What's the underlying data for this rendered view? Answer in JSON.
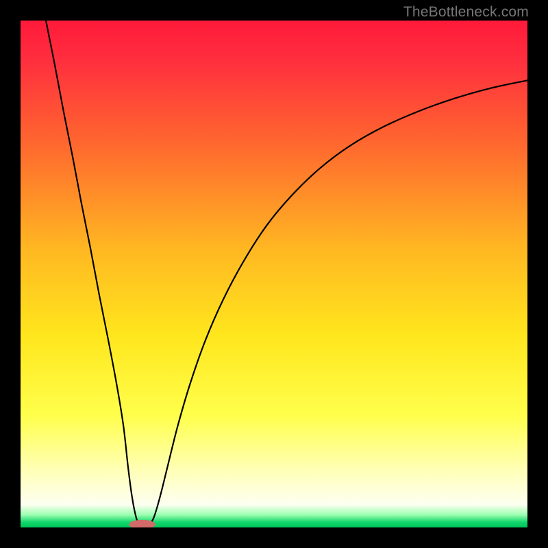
{
  "watermark": "TheBottleneck.com",
  "chart_data": {
    "type": "line",
    "title": "",
    "xlabel": "",
    "ylabel": "",
    "xlim": [
      0,
      100
    ],
    "ylim": [
      0,
      100
    ],
    "gradient_stops": [
      {
        "offset": 0,
        "color": "#ff1a3a"
      },
      {
        "offset": 0.08,
        "color": "#ff2f3e"
      },
      {
        "offset": 0.25,
        "color": "#ff6a2e"
      },
      {
        "offset": 0.45,
        "color": "#ffb722"
      },
      {
        "offset": 0.62,
        "color": "#ffe61d"
      },
      {
        "offset": 0.78,
        "color": "#ffff4c"
      },
      {
        "offset": 0.88,
        "color": "#ffffb0"
      },
      {
        "offset": 0.955,
        "color": "#fdfff1"
      },
      {
        "offset": 0.975,
        "color": "#9cffb0"
      },
      {
        "offset": 0.99,
        "color": "#0fd66a"
      },
      {
        "offset": 1.0,
        "color": "#00c55a"
      }
    ],
    "series": [
      {
        "name": "curve",
        "stroke": "#000000",
        "stroke_width": 2.2,
        "points": [
          {
            "x": 5.0,
            "y": 100.0
          },
          {
            "x": 6.8,
            "y": 91.0
          },
          {
            "x": 8.5,
            "y": 82.0
          },
          {
            "x": 10.3,
            "y": 73.0
          },
          {
            "x": 12.0,
            "y": 64.0
          },
          {
            "x": 13.8,
            "y": 55.0
          },
          {
            "x": 15.5,
            "y": 46.0
          },
          {
            "x": 17.3,
            "y": 37.0
          },
          {
            "x": 19.0,
            "y": 28.0
          },
          {
            "x": 20.3,
            "y": 20.0
          },
          {
            "x": 21.2,
            "y": 12.0
          },
          {
            "x": 22.0,
            "y": 6.0
          },
          {
            "x": 22.8,
            "y": 2.0
          },
          {
            "x": 23.5,
            "y": 0.5
          },
          {
            "x": 24.3,
            "y": 0.0
          },
          {
            "x": 25.3,
            "y": 0.5
          },
          {
            "x": 26.3,
            "y": 2.0
          },
          {
            "x": 27.5,
            "y": 6.0
          },
          {
            "x": 29.0,
            "y": 12.0
          },
          {
            "x": 31.0,
            "y": 20.0
          },
          {
            "x": 33.5,
            "y": 28.5
          },
          {
            "x": 36.5,
            "y": 37.0
          },
          {
            "x": 40.0,
            "y": 45.0
          },
          {
            "x": 44.0,
            "y": 52.5
          },
          {
            "x": 48.5,
            "y": 59.5
          },
          {
            "x": 53.5,
            "y": 65.5
          },
          {
            "x": 59.0,
            "y": 70.8
          },
          {
            "x": 65.0,
            "y": 75.3
          },
          {
            "x": 71.5,
            "y": 79.0
          },
          {
            "x": 78.5,
            "y": 82.1
          },
          {
            "x": 85.5,
            "y": 84.6
          },
          {
            "x": 92.5,
            "y": 86.6
          },
          {
            "x": 100.0,
            "y": 88.2
          }
        ]
      }
    ],
    "marker": {
      "name": "minimum-marker",
      "color": "#d36a6a",
      "cx": 24.0,
      "cy": 0.6,
      "rx": 2.6,
      "ry": 0.9
    }
  }
}
